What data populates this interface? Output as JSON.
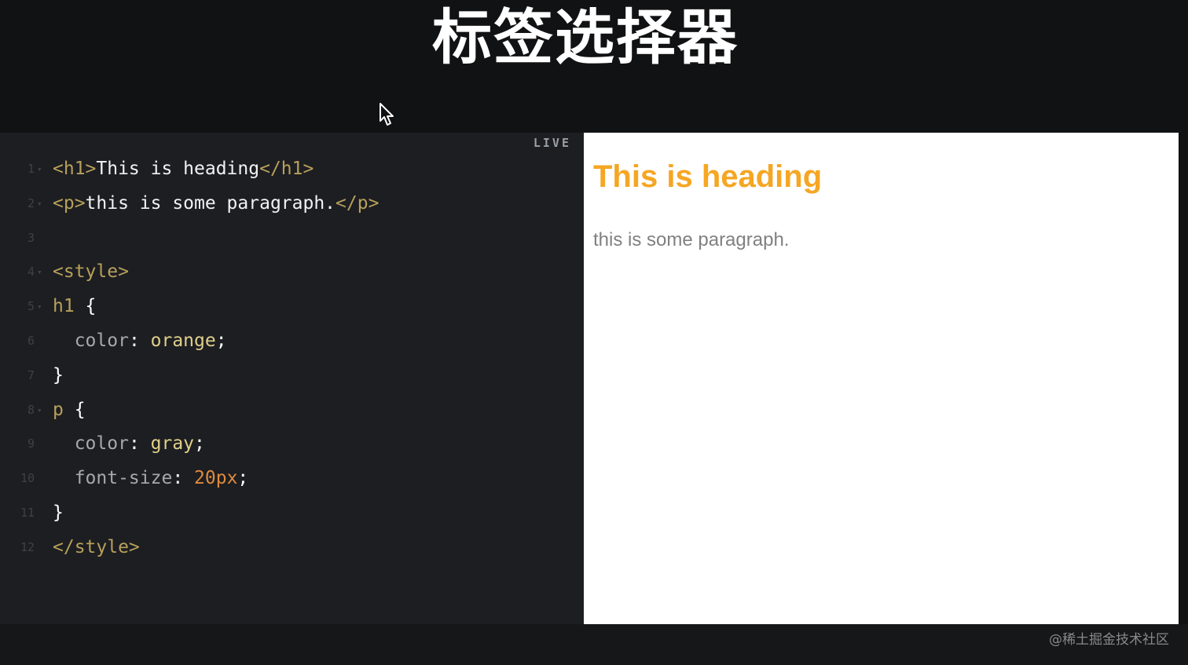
{
  "title": "标签选择器",
  "editor": {
    "live_label": "LIVE",
    "lines": [
      {
        "num": "1",
        "fold": "▾",
        "tokens": [
          {
            "t": "<h1>",
            "c": "tag"
          },
          {
            "t": "This is heading",
            "c": "white"
          },
          {
            "t": "</h1>",
            "c": "tag"
          }
        ]
      },
      {
        "num": "2",
        "fold": "▾",
        "tokens": [
          {
            "t": "<p>",
            "c": "tag"
          },
          {
            "t": "this is some paragraph.",
            "c": "white"
          },
          {
            "t": "</p>",
            "c": "tag"
          }
        ]
      },
      {
        "num": "3",
        "fold": "",
        "tokens": []
      },
      {
        "num": "4",
        "fold": "▾",
        "tokens": [
          {
            "t": "<style>",
            "c": "tag"
          }
        ]
      },
      {
        "num": "5",
        "fold": "▾",
        "tokens": [
          {
            "t": "h1",
            "c": "sel"
          },
          {
            "t": " {",
            "c": "punc"
          }
        ]
      },
      {
        "num": "6",
        "fold": "",
        "tokens": [
          {
            "t": "  color",
            "c": "prop"
          },
          {
            "t": ": ",
            "c": "punc"
          },
          {
            "t": "orange",
            "c": "val"
          },
          {
            "t": ";",
            "c": "punc"
          }
        ]
      },
      {
        "num": "7",
        "fold": "",
        "tokens": [
          {
            "t": "}",
            "c": "punc"
          }
        ]
      },
      {
        "num": "8",
        "fold": "▾",
        "tokens": [
          {
            "t": "p",
            "c": "sel"
          },
          {
            "t": " {",
            "c": "punc"
          }
        ]
      },
      {
        "num": "9",
        "fold": "",
        "tokens": [
          {
            "t": "  color",
            "c": "prop"
          },
          {
            "t": ": ",
            "c": "punc"
          },
          {
            "t": "gray",
            "c": "val"
          },
          {
            "t": ";",
            "c": "punc"
          }
        ]
      },
      {
        "num": "10",
        "fold": "",
        "tokens": [
          {
            "t": "  font-size",
            "c": "prop"
          },
          {
            "t": ": ",
            "c": "punc"
          },
          {
            "t": "20px",
            "c": "num"
          },
          {
            "t": ";",
            "c": "punc"
          }
        ]
      },
      {
        "num": "11",
        "fold": "",
        "tokens": [
          {
            "t": "}",
            "c": "punc"
          }
        ]
      },
      {
        "num": "12",
        "fold": "",
        "tokens": [
          {
            "t": "</style>",
            "c": "tag"
          }
        ]
      }
    ]
  },
  "preview": {
    "heading": "This is heading",
    "paragraph": "this is some paragraph.",
    "heading_color": "#f5a623",
    "paragraph_color": "#808080"
  },
  "watermark": "@稀土掘金技术社区",
  "icons": {
    "cursor": "mouse-pointer-icon"
  }
}
